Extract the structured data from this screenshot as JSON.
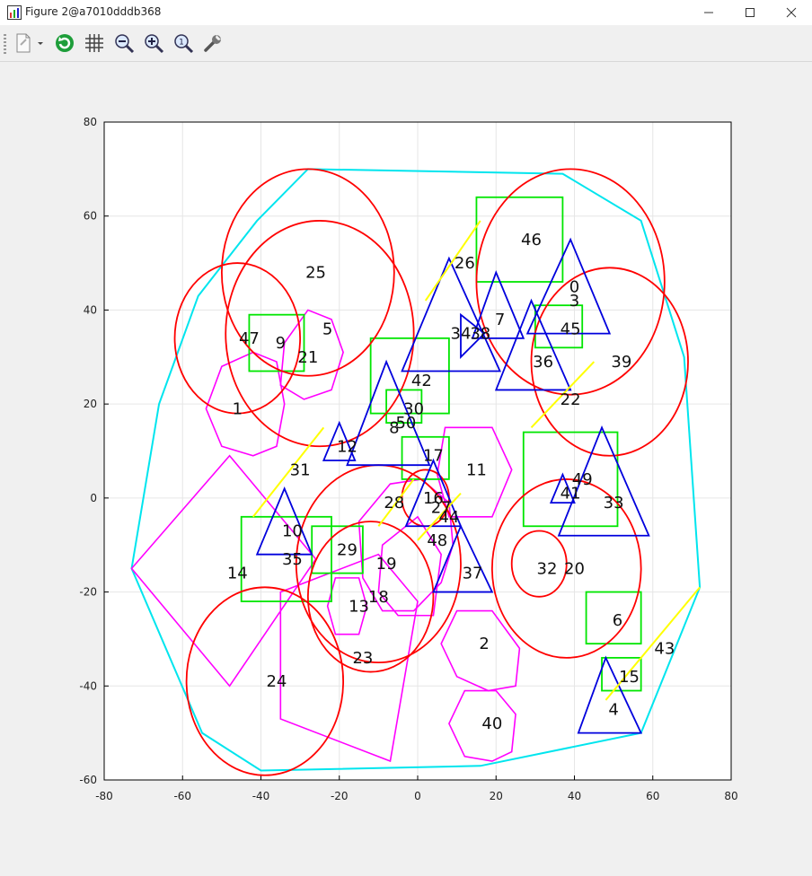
{
  "window": {
    "title": "Figure 2@a7010dddb368"
  },
  "toolbar": {
    "buttons": [
      {
        "name": "new-figure-button",
        "icon": "document-new-icon"
      },
      {
        "name": "refresh-button",
        "icon": "refresh-icon"
      },
      {
        "name": "grid-toggle-button",
        "icon": "grid-icon"
      },
      {
        "name": "zoom-out-button",
        "icon": "zoom-out-icon"
      },
      {
        "name": "zoom-in-button",
        "icon": "zoom-in-icon"
      },
      {
        "name": "zoom-reset-button",
        "icon": "zoom-reset-icon"
      },
      {
        "name": "settings-button",
        "icon": "wrench-icon"
      }
    ]
  },
  "colors": {
    "circle": "#ff0000",
    "triangle": "#0000dd",
    "square": "#00e600",
    "polygon": "#ff00ff",
    "line": "#ffff00",
    "hull": "#00e5ee"
  },
  "chart_data": {
    "type": "scatter",
    "xlim": [
      -80,
      80
    ],
    "ylim": [
      -60,
      80
    ],
    "x_ticks": [
      "-80",
      "-60",
      "-40",
      "-20",
      "0",
      "20",
      "40",
      "60",
      "80"
    ],
    "y_ticks": [
      "80",
      "60",
      "40",
      "20",
      "0",
      "-20",
      "-40",
      "-60"
    ],
    "grid": true,
    "labels": [
      {
        "text": "0",
        "x": 40,
        "y": 45
      },
      {
        "text": "1",
        "x": -46,
        "y": 19
      },
      {
        "text": "2",
        "x": 17,
        "y": -31
      },
      {
        "text": "3",
        "x": 40,
        "y": 42
      },
      {
        "text": "4",
        "x": 50,
        "y": -45
      },
      {
        "text": "5",
        "x": -23,
        "y": 36
      },
      {
        "text": "6",
        "x": 51,
        "y": -26
      },
      {
        "text": "7",
        "x": 21,
        "y": 38
      },
      {
        "text": "8",
        "x": -6,
        "y": 15
      },
      {
        "text": "9",
        "x": -35,
        "y": 33
      },
      {
        "text": "10",
        "x": -32,
        "y": -7
      },
      {
        "text": "11",
        "x": 15,
        "y": 6
      },
      {
        "text": "12",
        "x": -18,
        "y": 11
      },
      {
        "text": "13",
        "x": -15,
        "y": -23
      },
      {
        "text": "15",
        "x": 54,
        "y": -38
      },
      {
        "text": "14",
        "x": -46,
        "y": -16
      },
      {
        "text": "16",
        "x": 4,
        "y": 0
      },
      {
        "text": "17",
        "x": 4,
        "y": 9
      },
      {
        "text": "18",
        "x": -10,
        "y": -21
      },
      {
        "text": "19",
        "x": -8,
        "y": -14
      },
      {
        "text": "20",
        "x": 40,
        "y": -15
      },
      {
        "text": "21",
        "x": -28,
        "y": 30
      },
      {
        "text": "22",
        "x": 39,
        "y": 21
      },
      {
        "text": "23",
        "x": -14,
        "y": -34
      },
      {
        "text": "24",
        "x": -36,
        "y": -39
      },
      {
        "text": "25",
        "x": -26,
        "y": 48
      },
      {
        "text": "26",
        "x": 12,
        "y": 50
      },
      {
        "text": "27",
        "x": 6,
        "y": -2
      },
      {
        "text": "28",
        "x": -6,
        "y": -1
      },
      {
        "text": "29",
        "x": -18,
        "y": -11
      },
      {
        "text": "30",
        "x": -1,
        "y": 19
      },
      {
        "text": "31",
        "x": -30,
        "y": 6
      },
      {
        "text": "32",
        "x": 33,
        "y": -15
      },
      {
        "text": "33",
        "x": 50,
        "y": -1
      },
      {
        "text": "34",
        "x": 11,
        "y": 35
      },
      {
        "text": "35",
        "x": -32,
        "y": -13
      },
      {
        "text": "36",
        "x": 32,
        "y": 29
      },
      {
        "text": "37",
        "x": 14,
        "y": -16
      },
      {
        "text": "38",
        "x": 16,
        "y": 35
      },
      {
        "text": "39",
        "x": 52,
        "y": 29
      },
      {
        "text": "40",
        "x": 19,
        "y": -48
      },
      {
        "text": "41",
        "x": 39,
        "y": 1
      },
      {
        "text": "42",
        "x": 1,
        "y": 25
      },
      {
        "text": "43",
        "x": 63,
        "y": -32
      },
      {
        "text": "44",
        "x": 8,
        "y": -4
      },
      {
        "text": "45",
        "x": 39,
        "y": 36
      },
      {
        "text": "46",
        "x": 29,
        "y": 55
      },
      {
        "text": "47",
        "x": -43,
        "y": 34
      },
      {
        "text": "48",
        "x": 5,
        "y": -9
      },
      {
        "text": "49",
        "x": 42,
        "y": 4
      },
      {
        "text": "50",
        "x": -3,
        "y": 16
      }
    ],
    "circles": [
      {
        "cx": -28,
        "cy": 48,
        "r": 22
      },
      {
        "cx": -25,
        "cy": 35,
        "r": 24
      },
      {
        "cx": -46,
        "cy": 34,
        "r": 16
      },
      {
        "cx": 39,
        "cy": 46,
        "r": 24
      },
      {
        "cx": 49,
        "cy": 29,
        "r": 20
      },
      {
        "cx": 38,
        "cy": -15,
        "r": 19
      },
      {
        "cx": 31,
        "cy": -14,
        "r": 7
      },
      {
        "cx": -10,
        "cy": -14,
        "r": 21
      },
      {
        "cx": -12,
        "cy": -21,
        "r": 16
      },
      {
        "cx": -39,
        "cy": -39,
        "r": 20
      },
      {
        "cx": 2,
        "cy": 0,
        "r": 6
      }
    ],
    "squares": [
      {
        "x0": 15,
        "y0": 46,
        "x1": 37,
        "y1": 64
      },
      {
        "x0": 30,
        "y0": 32,
        "x1": 42,
        "y1": 41
      },
      {
        "x0": -43,
        "y0": 27,
        "x1": -29,
        "y1": 39
      },
      {
        "x0": -12,
        "y0": 18,
        "x1": 8,
        "y1": 34
      },
      {
        "x0": -8,
        "y0": 16,
        "x1": 1,
        "y1": 23
      },
      {
        "x0": -4,
        "y0": 4,
        "x1": 8,
        "y1": 13
      },
      {
        "x0": 27,
        "y0": -6,
        "x1": 51,
        "y1": 14
      },
      {
        "x0": -45,
        "y0": -22,
        "x1": -22,
        "y1": -4
      },
      {
        "x0": -27,
        "y0": -16,
        "x1": -14,
        "y1": -6
      },
      {
        "x0": 43,
        "y0": -31,
        "x1": 57,
        "y1": -20
      },
      {
        "x0": 47,
        "y0": -41,
        "x1": 57,
        "y1": -34
      }
    ],
    "triangles": [
      {
        "pts": [
          [
            -4,
            27
          ],
          [
            8,
            51
          ],
          [
            21,
            27
          ]
        ]
      },
      {
        "pts": [
          [
            14,
            34
          ],
          [
            20,
            48
          ],
          [
            27,
            34
          ]
        ]
      },
      {
        "pts": [
          [
            28,
            35
          ],
          [
            39,
            55
          ],
          [
            49,
            35
          ]
        ]
      },
      {
        "pts": [
          [
            20,
            23
          ],
          [
            29,
            42
          ],
          [
            39,
            23
          ]
        ]
      },
      {
        "pts": [
          [
            -18,
            7
          ],
          [
            -8,
            29
          ],
          [
            3,
            7
          ]
        ]
      },
      {
        "pts": [
          [
            -24,
            8
          ],
          [
            -20,
            16
          ],
          [
            -16,
            8
          ]
        ]
      },
      {
        "pts": [
          [
            -3,
            -6
          ],
          [
            4,
            8
          ],
          [
            11,
            -6
          ]
        ]
      },
      {
        "pts": [
          [
            4,
            -20
          ],
          [
            11,
            -6
          ],
          [
            19,
            -20
          ]
        ]
      },
      {
        "pts": [
          [
            -41,
            -12
          ],
          [
            -34,
            2
          ],
          [
            -27,
            -12
          ]
        ]
      },
      {
        "pts": [
          [
            34,
            -1
          ],
          [
            37,
            5
          ],
          [
            40,
            -1
          ]
        ]
      },
      {
        "pts": [
          [
            36,
            -8
          ],
          [
            47,
            15
          ],
          [
            59,
            -8
          ]
        ]
      },
      {
        "pts": [
          [
            41,
            -50
          ],
          [
            48,
            -34
          ],
          [
            57,
            -50
          ]
        ]
      },
      {
        "pts": [
          [
            11,
            30
          ],
          [
            11,
            39
          ],
          [
            17,
            35
          ]
        ]
      }
    ],
    "polygons": [
      {
        "pts": [
          [
            -50,
            28
          ],
          [
            -42,
            31
          ],
          [
            -36,
            29
          ],
          [
            -34,
            20
          ],
          [
            -36,
            11
          ],
          [
            -42,
            9
          ],
          [
            -50,
            11
          ],
          [
            -54,
            19
          ]
        ]
      },
      {
        "pts": [
          [
            -34,
            33
          ],
          [
            -28,
            40
          ],
          [
            -22,
            38
          ],
          [
            -19,
            31
          ],
          [
            -22,
            23
          ],
          [
            -29,
            21
          ],
          [
            -35,
            24
          ]
        ]
      },
      {
        "pts": [
          [
            7,
            15
          ],
          [
            19,
            15
          ],
          [
            24,
            6
          ],
          [
            19,
            -4
          ],
          [
            8,
            -4
          ],
          [
            5,
            5
          ]
        ]
      },
      {
        "pts": [
          [
            -73,
            -15
          ],
          [
            -48,
            9
          ],
          [
            -26,
            -13
          ],
          [
            -48,
            -40
          ]
        ]
      },
      {
        "pts": [
          [
            -35,
            -20
          ],
          [
            -10,
            -12
          ],
          [
            0,
            -22
          ],
          [
            -7,
            -56
          ],
          [
            -35,
            -47
          ]
        ]
      },
      {
        "pts": [
          [
            -15,
            -5
          ],
          [
            -7,
            3
          ],
          [
            1,
            4
          ],
          [
            8,
            -1
          ],
          [
            9,
            -10
          ],
          [
            6,
            -18
          ],
          [
            -1,
            -24
          ],
          [
            -9,
            -24
          ],
          [
            -14,
            -17
          ]
        ]
      },
      {
        "pts": [
          [
            10,
            -24
          ],
          [
            19,
            -24
          ],
          [
            26,
            -32
          ],
          [
            25,
            -40
          ],
          [
            18,
            -41
          ],
          [
            10,
            -38
          ],
          [
            6,
            -31
          ]
        ]
      },
      {
        "pts": [
          [
            12,
            -41
          ],
          [
            20,
            -41
          ],
          [
            25,
            -46
          ],
          [
            24,
            -54
          ],
          [
            19,
            -56
          ],
          [
            12,
            -55
          ],
          [
            8,
            -48
          ]
        ]
      },
      {
        "pts": [
          [
            -21,
            -29
          ],
          [
            -15,
            -29
          ],
          [
            -13,
            -23
          ],
          [
            -15,
            -17
          ],
          [
            -21,
            -17
          ],
          [
            -23,
            -23
          ]
        ]
      },
      {
        "pts": [
          [
            -9,
            -10
          ],
          [
            0,
            -4
          ],
          [
            6,
            -12
          ],
          [
            4,
            -25
          ],
          [
            -5,
            -25
          ],
          [
            -10,
            -20
          ]
        ]
      }
    ],
    "lines": [
      {
        "x0": 2,
        "y0": 42,
        "x1": 16,
        "y1": 59
      },
      {
        "x0": 29,
        "y0": 15,
        "x1": 45,
        "y1": 29
      },
      {
        "x0": -42,
        "y0": -4,
        "x1": -24,
        "y1": 15
      },
      {
        "x0": -10,
        "y0": -6,
        "x1": -1,
        "y1": 4
      },
      {
        "x0": 0,
        "y0": -9,
        "x1": 11,
        "y1": 1
      },
      {
        "x0": 48,
        "y0": -43,
        "x1": 72,
        "y1": -19
      }
    ],
    "hull": {
      "pts": [
        [
          -41,
          59
        ],
        [
          -28,
          70
        ],
        [
          37,
          69
        ],
        [
          57,
          59
        ],
        [
          68,
          30
        ],
        [
          72,
          -19
        ],
        [
          57,
          -50
        ],
        [
          16,
          -57
        ],
        [
          -40,
          -58
        ],
        [
          -55,
          -50
        ],
        [
          -73,
          -15
        ],
        [
          -66,
          20
        ],
        [
          -56,
          43
        ]
      ]
    }
  }
}
